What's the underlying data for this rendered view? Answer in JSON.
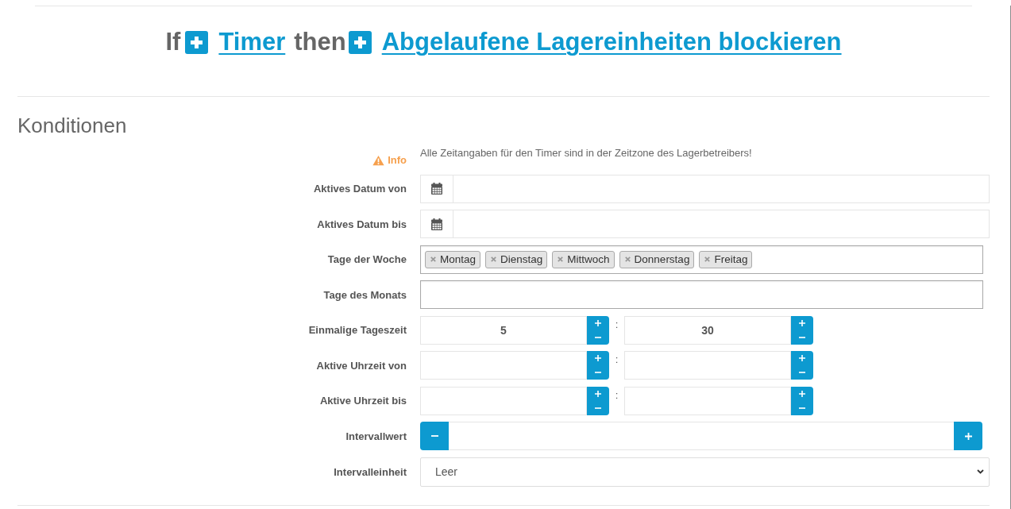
{
  "header": {
    "if_text": "If",
    "trigger_link": "Timer",
    "then_text": "then",
    "action_link": "Abgelaufene Lagereinheiten blockieren"
  },
  "section": {
    "title": "Konditionen"
  },
  "fields": [
    {
      "kind": "info",
      "label": "Info",
      "text": "Alle Zeitangaben für den Timer sind in der Zeitzone des Lagerbetreibers!"
    },
    {
      "kind": "date",
      "label": "Aktives Datum von"
    },
    {
      "kind": "date",
      "label": "Aktives Datum bis"
    },
    {
      "kind": "tags",
      "label": "Tage der Woche",
      "tags": [
        "Montag",
        "Dienstag",
        "Mittwoch",
        "Donnerstag",
        "Freitag"
      ]
    },
    {
      "kind": "text",
      "label": "Tage des Monats"
    },
    {
      "kind": "time",
      "label": "Einmalige Tageszeit",
      "hours": "5",
      "separator": ":",
      "minutes": "30"
    },
    {
      "kind": "time",
      "label": "Aktive Uhrzeit von",
      "separator": ":"
    },
    {
      "kind": "time",
      "label": "Aktive Uhrzeit bis",
      "separator": ":"
    },
    {
      "kind": "stepper",
      "label": "Intervallwert"
    },
    {
      "kind": "select",
      "label": "Intervalleinheit",
      "value": "Leer"
    }
  ]
}
